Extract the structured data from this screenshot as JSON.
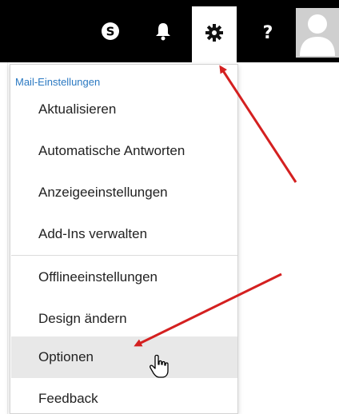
{
  "topbar": {
    "icons": [
      "skype-icon",
      "bell-icon",
      "gear-icon",
      "help-icon",
      "avatar-icon"
    ],
    "help_label": "?",
    "skype_letter": "S",
    "active": "gear-icon"
  },
  "menu": {
    "heading": "Mail-Einstellungen",
    "items": [
      {
        "label": "Aktualisieren"
      },
      {
        "label": "Automatische Antworten"
      },
      {
        "label": "Anzeigeeinstellungen"
      },
      {
        "label": "Add-Ins verwalten"
      },
      {
        "label": "Offlineeinstellungen"
      },
      {
        "label": "Design ändern"
      },
      {
        "label": "Optionen"
      },
      {
        "label": "Feedback"
      }
    ],
    "hovered_item": "Optionen"
  },
  "colors": {
    "topbar": "#000000",
    "heading": "#2b79c2",
    "arrow": "#d42020",
    "hover": "#e8e8e8"
  }
}
